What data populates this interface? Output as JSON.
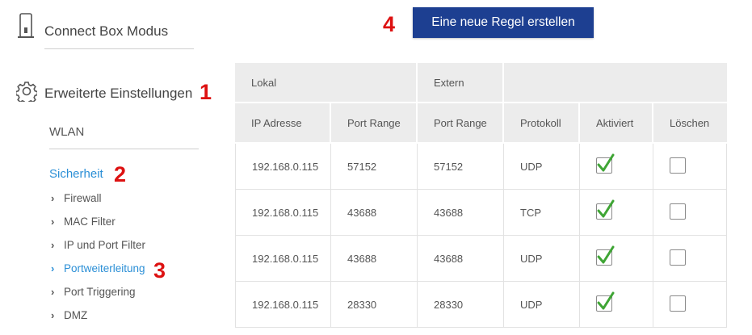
{
  "sidebar": {
    "connect_box_label": "Connect Box Modus",
    "advanced_label": "Erweiterte Einstellungen",
    "marker_advanced": "1",
    "wlan_label": "WLAN",
    "security_label": "Sicherheit",
    "marker_security": "2",
    "sub_items": [
      {
        "label": "Firewall"
      },
      {
        "label": "MAC Filter"
      },
      {
        "label": "IP und Port Filter"
      },
      {
        "label": "Portweiterleitung",
        "active": true
      },
      {
        "label": "Port Triggering"
      },
      {
        "label": "DMZ"
      }
    ],
    "marker_portforward": "3"
  },
  "toolbar": {
    "marker_button": "4",
    "new_rule_label": "Eine neue Regel erstellen"
  },
  "table": {
    "group_headers": {
      "local": "Lokal",
      "external": "Extern",
      "rest": ""
    },
    "columns": [
      "IP Adresse",
      "Port Range",
      "Port Range",
      "Protokoll",
      "Aktiviert",
      "Löschen"
    ],
    "rows": [
      {
        "ip": "192.168.0.115",
        "local_port": "57152",
        "external_port": "57152",
        "protocol": "UDP",
        "enabled": true,
        "delete": false
      },
      {
        "ip": "192.168.0.115",
        "local_port": "43688",
        "external_port": "43688",
        "protocol": "TCP",
        "enabled": true,
        "delete": false
      },
      {
        "ip": "192.168.0.115",
        "local_port": "43688",
        "external_port": "43688",
        "protocol": "UDP",
        "enabled": true,
        "delete": false
      },
      {
        "ip": "192.168.0.115",
        "local_port": "28330",
        "external_port": "28330",
        "protocol": "UDP",
        "enabled": true,
        "delete": false
      }
    ]
  },
  "colors": {
    "accent_link": "#2b8fd6",
    "button_bg": "#1d3f91",
    "marker_red": "#dd1111",
    "check_green": "#3fa535"
  }
}
